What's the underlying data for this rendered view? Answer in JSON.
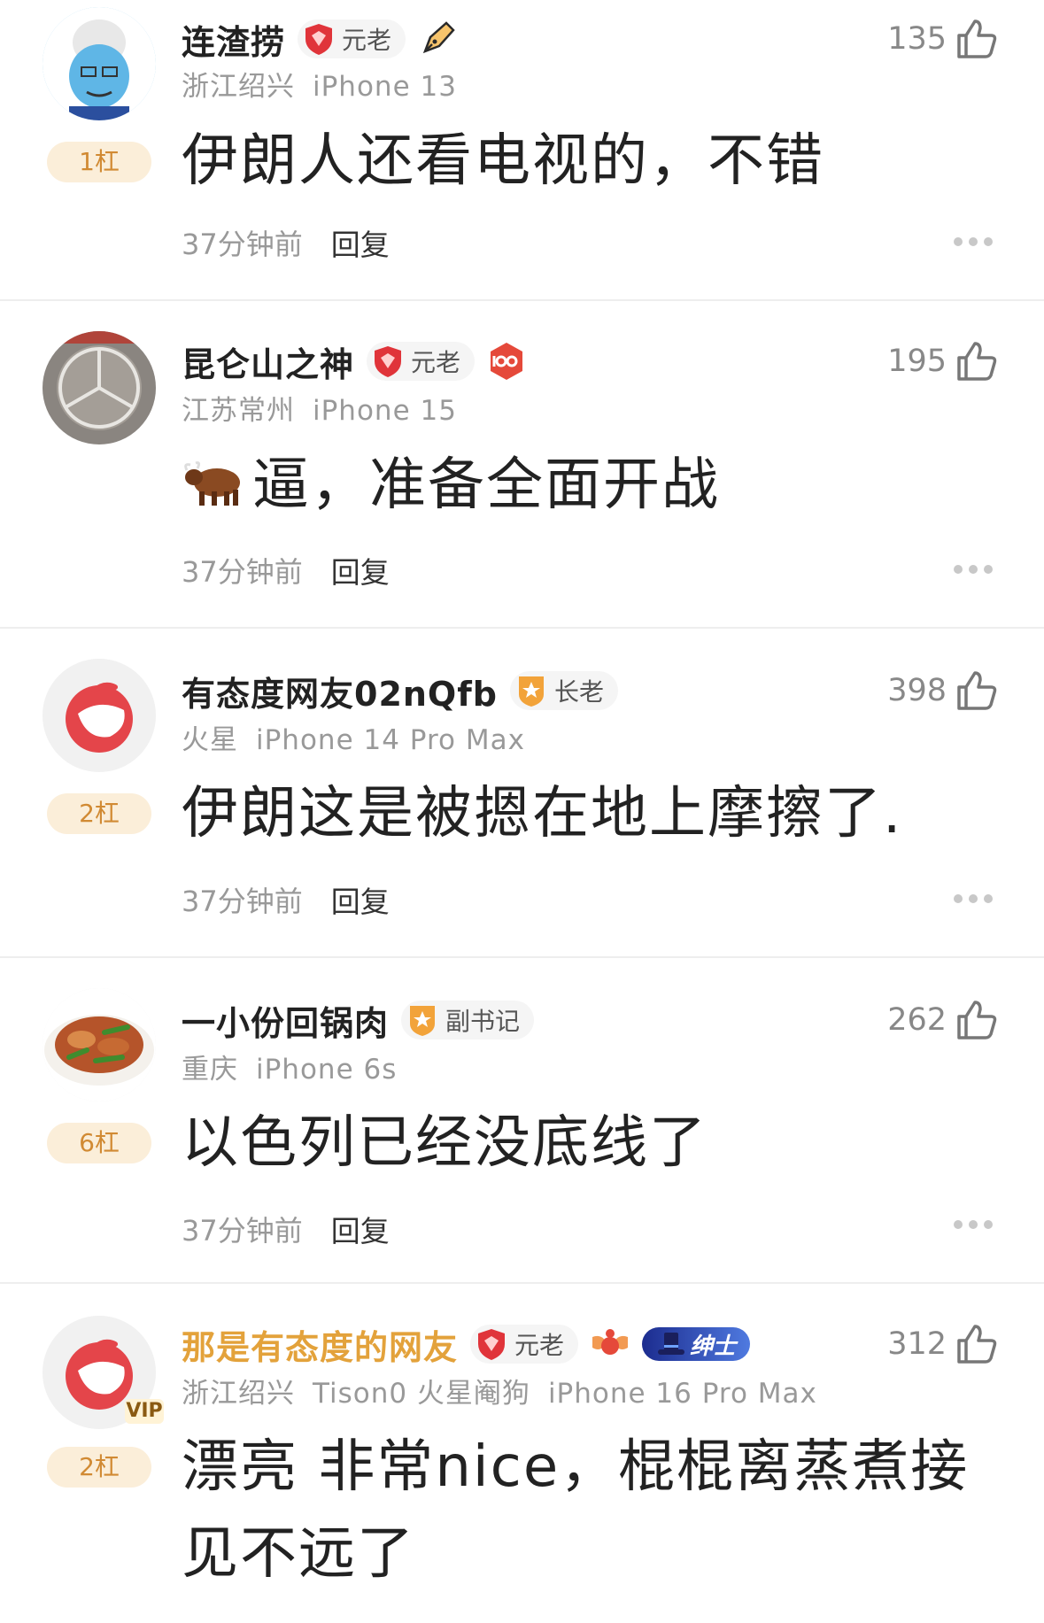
{
  "comments": [
    {
      "username": "连渣捞",
      "badge": "元老",
      "location": "浙江绍兴",
      "device": "iPhone 13",
      "likes": "135",
      "floor": "1杠",
      "content": "伊朗人还看电视的，不错",
      "time": "37分钟前",
      "reply": "回复",
      "extra_icon": "pen-icon"
    },
    {
      "username": "昆仑山之神",
      "badge": "元老",
      "location": "江苏常州",
      "device": "iPhone 15",
      "likes": "195",
      "content": "逼，准备全面开战",
      "content_emoji": "ox-emoji",
      "time": "37分钟前",
      "reply": "回复",
      "extra_icon": "100-medal-icon"
    },
    {
      "username": "有态度网友02nQfb",
      "badge": "长老",
      "location": "火星",
      "device": "iPhone 14 Pro Max",
      "likes": "398",
      "floor": "2杠",
      "content": "伊朗这是被摁在地上摩擦了.",
      "time": "37分钟前",
      "reply": "回复"
    },
    {
      "username": "一小份回锅肉",
      "badge": "副书记",
      "location": "重庆",
      "device": "iPhone 6s",
      "likes": "262",
      "floor": "6杠",
      "content": "以色列已经没底线了",
      "time": "37分钟前",
      "reply": "回复"
    },
    {
      "username": "那是有态度的网友",
      "badge": "元老",
      "tag": "绅士",
      "location": "浙江绍兴",
      "channel": "Tison0 火星阉狗",
      "device": "iPhone 16 Pro Max",
      "likes": "312",
      "floor": "2杠",
      "vip": "VIP",
      "content": "漂亮 非常nice，棍棍离蒸煮接见不远了"
    }
  ],
  "colors": {
    "floor_bg": "#fbeed9",
    "floor_text": "#d18a33",
    "vip_name": "#e3a23b",
    "badge_red": "#e0343a",
    "badge_orange": "#f2a33a"
  }
}
